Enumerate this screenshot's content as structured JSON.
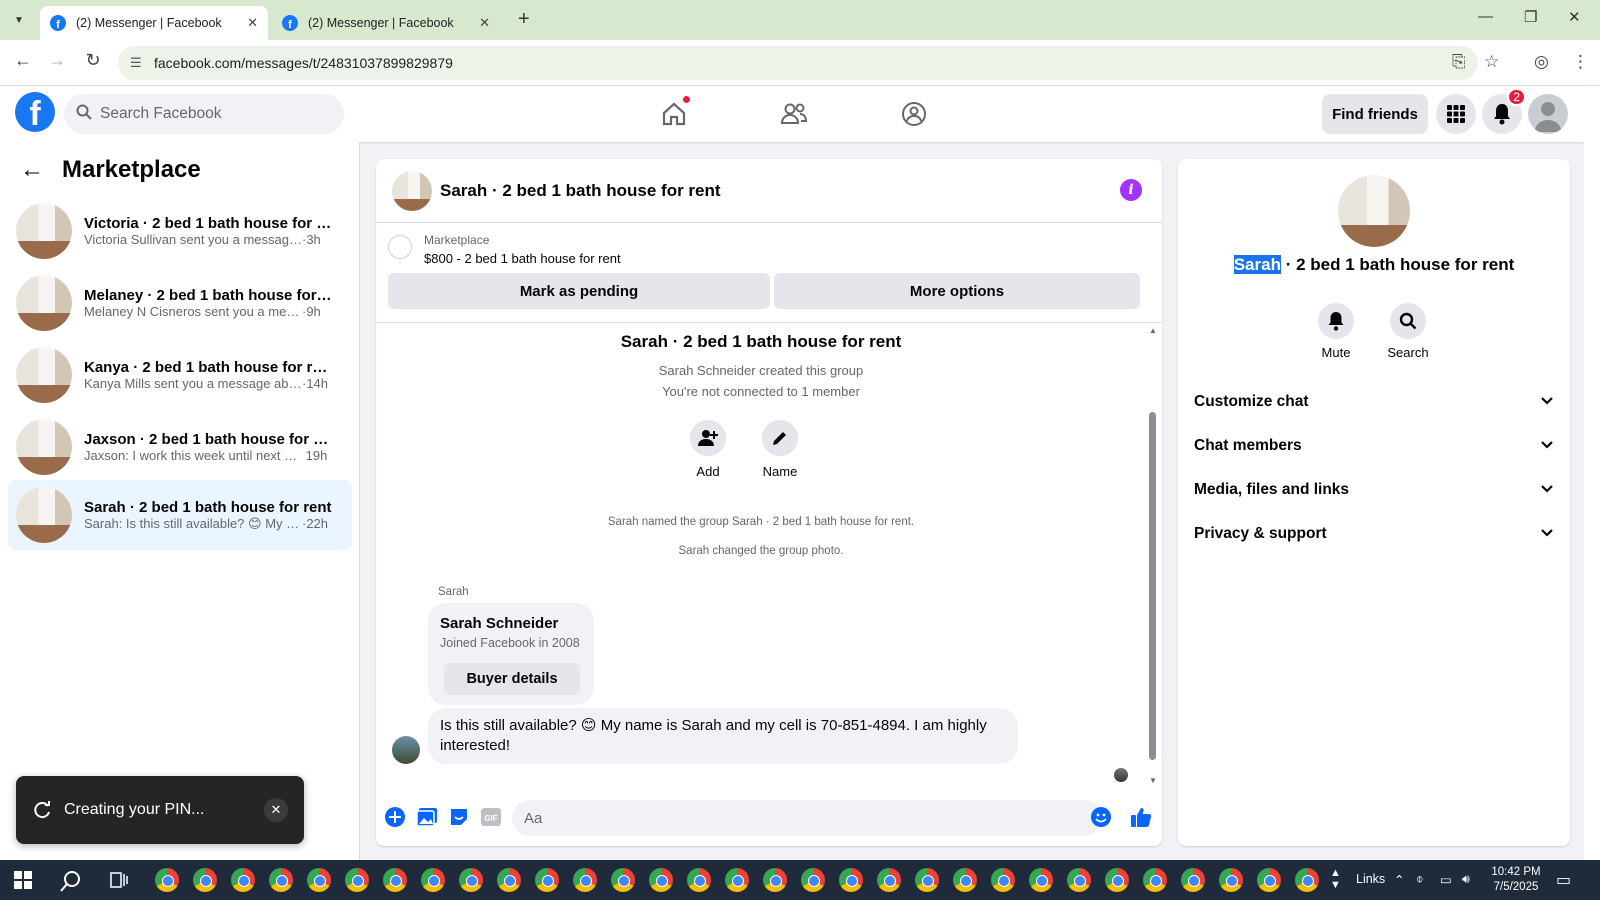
{
  "browser": {
    "tabs": [
      {
        "title": "(2) Messenger | Facebook",
        "active": true
      },
      {
        "title": "(2) Messenger | Facebook",
        "active": false
      }
    ],
    "url": "facebook.com/messages/t/24831037899829879"
  },
  "fb_header": {
    "search_placeholder": "Search Facebook",
    "find_friends_label": "Find friends",
    "notification_count": "2",
    "brand_color": "#1877f2"
  },
  "sidebar": {
    "title": "Marketplace",
    "conversations": [
      {
        "name": "Victoria · 2 bed 1 bath house for re...",
        "preview": "Victoria Sullivan sent you a message a...",
        "time": "·3h"
      },
      {
        "name": "Melaney · 2 bed 1 bath house for r...",
        "preview": "Melaney N Cisneros sent you a messa...",
        "time": "·9h"
      },
      {
        "name": "Kanya · 2 bed 1 bath house for rent",
        "preview": "Kanya Mills sent you a message abo...",
        "time": "·14h"
      },
      {
        "name": "Jaxson · 2 bed 1 bath house for rent",
        "preview": "Jaxson: I work this week until next Fri...",
        "time": "19h"
      },
      {
        "name": "Sarah · 2 bed 1 bath house for rent",
        "preview": "Sarah: Is this still available? 😊 My n...",
        "time": "·22h"
      }
    ]
  },
  "chat": {
    "title": "Sarah · 2 bed 1 bath house for rent",
    "marketplace_label": "Marketplace",
    "listing": "$800 - 2 bed 1 bath house for rent",
    "mark_pending_label": "Mark as pending",
    "more_options_label": "More options",
    "group_title": "Sarah · 2 bed 1 bath house for rent",
    "created_text": "Sarah Schneider created this group",
    "not_connected_text": "You're not connected to 1 member",
    "add_label": "Add",
    "name_label": "Name",
    "sys_named": "Sarah named the group Sarah · 2 bed 1 bath house for rent.",
    "sys_photo": "Sarah changed the group photo.",
    "sender_name": "Sarah",
    "card_name": "Sarah Schneider",
    "card_joined": "Joined Facebook in 2008",
    "buyer_details_label": "Buyer details",
    "message_text": "Is this still available? 😊 My name is Sarah and my cell is 70-851-4894. I am highly interested!",
    "composer_placeholder": "Aa"
  },
  "details": {
    "name_highlight": "Sarah",
    "name_rest": " · 2 bed 1 bath house for rent",
    "mute_label": "Mute",
    "search_label": "Search",
    "sections": [
      "Customize chat",
      "Chat members",
      "Media, files and links",
      "Privacy & support"
    ]
  },
  "toast": {
    "text": "Creating your PIN..."
  },
  "taskbar": {
    "links_label": "Links",
    "time": "10:42 PM",
    "date": "7/5/2025"
  }
}
